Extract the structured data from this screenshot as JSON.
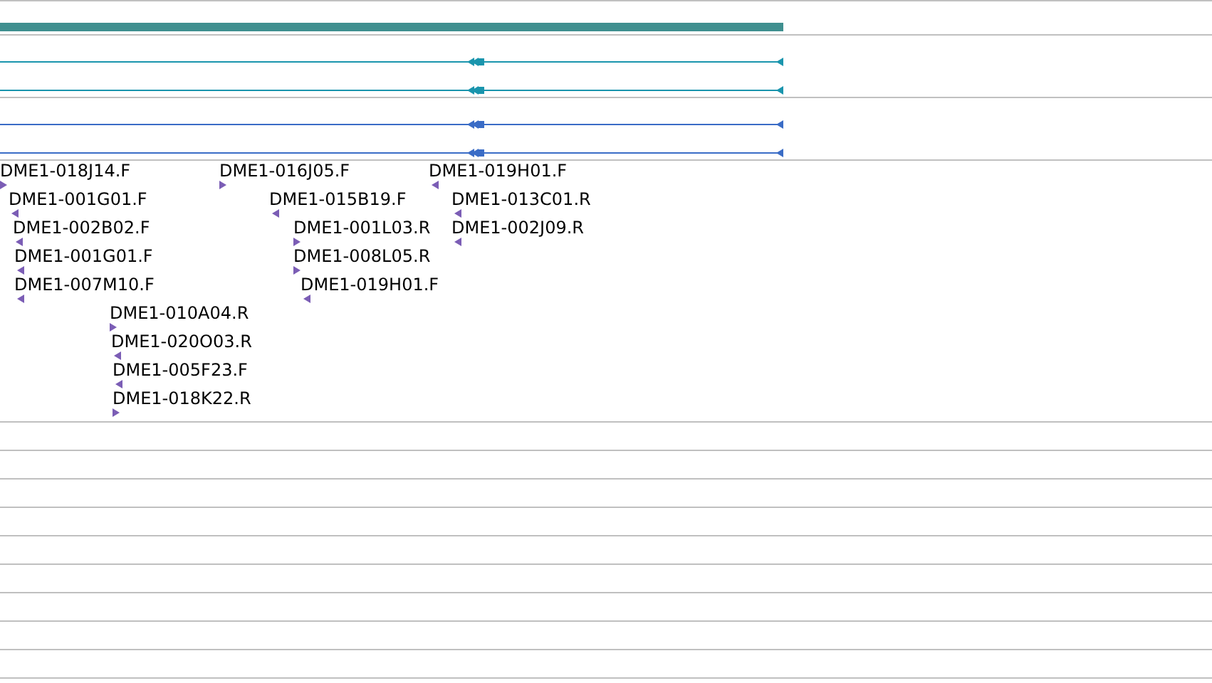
{
  "gene": {
    "color": "#3f8f8f"
  },
  "transcripts": [
    {
      "color": "#1a95ad"
    },
    {
      "color": "#1a95ad"
    },
    {
      "color": "#3a6cc6"
    },
    {
      "color": "#3a6cc6"
    }
  ],
  "reads": [
    {
      "label": "DME1-018J14.F",
      "reverse": false
    },
    {
      "label": "DME1-001G01.F",
      "reverse": true
    },
    {
      "label": "DME1-002B02.F",
      "reverse": true
    },
    {
      "label": "DME1-001G01.F",
      "reverse": true
    },
    {
      "label": "DME1-007M10.F",
      "reverse": true
    },
    {
      "label": "DME1-010A04.R",
      "reverse": false
    },
    {
      "label": "DME1-020O03.R",
      "reverse": true
    },
    {
      "label": "DME1-005F23.F",
      "reverse": true
    },
    {
      "label": "DME1-018K22.R",
      "reverse": false
    },
    {
      "label": "DME1-016J05.F",
      "reverse": false
    },
    {
      "label": "DME1-015B19.F",
      "reverse": true
    },
    {
      "label": "DME1-001L03.R",
      "reverse": false
    },
    {
      "label": "DME1-008L05.R",
      "reverse": false
    },
    {
      "label": "DME1-019H01.F",
      "reverse": true
    },
    {
      "label": "DME1-019H01.F",
      "reverse": true
    },
    {
      "label": "DME1-013C01.R",
      "reverse": true
    },
    {
      "label": "DME1-002J09.R",
      "reverse": true
    }
  ]
}
